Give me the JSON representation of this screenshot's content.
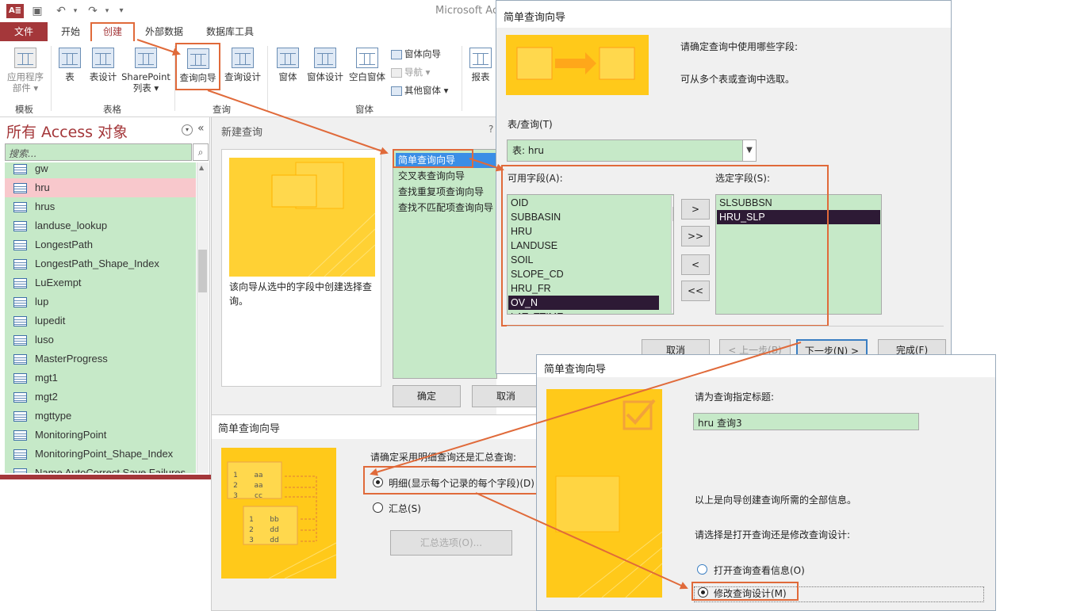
{
  "access": {
    "title": "Microsoft Ac",
    "logo": "A≣",
    "tabs": [
      "文件",
      "开始",
      "创建",
      "外部数据",
      "数据库工具"
    ],
    "ribbon": {
      "groups": [
        "模板",
        "表格",
        "查询",
        "窗体"
      ],
      "app_parts": [
        "应用程序",
        "部件 ▾"
      ],
      "table": "表",
      "table_design": "表设计",
      "sharepoint": [
        "SharePoint",
        "列表 ▾"
      ],
      "query_wizard": "查询向导",
      "query_design": "查询设计",
      "form": "窗体",
      "form_design": "窗体设计",
      "blank_form": "空白窗体",
      "form_wizard": "窗体向导",
      "navigation": "导航 ▾",
      "more_forms": "其他窗体 ▾",
      "report": "报表"
    },
    "nav": {
      "title": "所有 Access 对象",
      "search_placeholder": "搜索...",
      "items": [
        "gw",
        "hru",
        "hrus",
        "landuse_lookup",
        "LongestPath",
        "LongestPath_Shape_Index",
        "LuExempt",
        "lup",
        "lupedit",
        "luso",
        "MasterProgress",
        "mgt1",
        "mgt2",
        "mgttype",
        "MonitoringPoint",
        "MonitoringPoint_Shape_Index",
        "Name AutoCorrect Save Failures"
      ]
    }
  },
  "new_query": {
    "title": "新建查询",
    "help": "?",
    "options": [
      "简单查询向导",
      "交叉表查询向导",
      "查找重复项查询向导",
      "查找不匹配项查询向导"
    ],
    "description": "该向导从选中的字段中创建选择查询。",
    "ok": "确定",
    "cancel": "取消"
  },
  "wizard1": {
    "title": "简单查询向导",
    "prompt1": "请确定查询中使用哪些字段:",
    "prompt2": "可从多个表或查询中选取。",
    "table_label": "表/查询(T)",
    "table_value": "表: hru",
    "available_label": "可用字段(A):",
    "selected_label": "选定字段(S):",
    "available": [
      "OID",
      "SUBBASIN",
      "HRU",
      "LANDUSE",
      "SOIL",
      "SLOPE_CD",
      "HRU_FR",
      "OV_N",
      "LAT_TTIME"
    ],
    "selected": [
      "SLSUBBSN",
      "HRU_SLP"
    ],
    "move": [
      ">",
      ">>",
      "<",
      "<<"
    ],
    "cancel": "取消",
    "back": "< 上一步(B)",
    "next": "下一步(N) >",
    "finish": "完成(F)"
  },
  "wizard2": {
    "title": "简单查询向导",
    "question": "请确定采用明细查询还是汇总查询:",
    "detail": "明细(显示每个记录的每个字段)(D)",
    "summary": "汇总(S)",
    "summary_options": "汇总选项(O)...",
    "img_rows1": [
      [
        "1",
        "aa"
      ],
      [
        "2",
        "aa"
      ],
      [
        "3",
        "cc"
      ]
    ],
    "img_rows2": [
      [
        "1",
        "bb"
      ],
      [
        "2",
        "dd"
      ],
      [
        "3",
        "dd"
      ]
    ]
  },
  "wizard3": {
    "title": "简单查询向导",
    "title_prompt": "请为查询指定标题:",
    "title_value": "hru 查询3",
    "info": "以上是向导创建查询所需的全部信息。",
    "choice_prompt": "请选择是打开查询还是修改查询设计:",
    "open_option": "打开查询查看信息(O)",
    "modify_option": "修改查询设计(M)"
  },
  "colors": {
    "access_red": "#a4373a",
    "highlight": "#e06a3a",
    "list_green": "#c6e9c8",
    "wizard_yellow": "#ffd21f"
  }
}
